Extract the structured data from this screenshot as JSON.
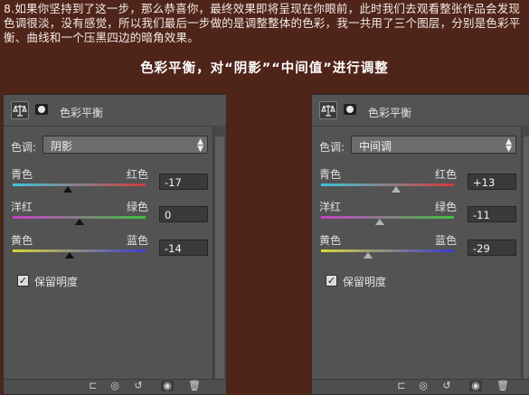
{
  "intro_text": "8.如果你坚持到了这一步，那么恭喜你，最终效果即将呈现在你眼前，此时我们去观看整张作品会发现色调很淡，没有感觉，所以我们最后一步做的是调整整体的色彩，我一共用了三个图层，分别是色彩平衡、曲线和一个压黑四边的暗角效果。",
  "headline": "色彩平衡，对“阴影”“中间值”进行调整",
  "panels": [
    {
      "title": "色彩平衡",
      "tone_label": "色调:",
      "tone_value": "阴影",
      "sliders": [
        {
          "left_label": "青色",
          "right_label": "红色",
          "value": "-17",
          "value_num": -17
        },
        {
          "left_label": "洋红",
          "right_label": "绿色",
          "value": "0",
          "value_num": 0
        },
        {
          "left_label": "黄色",
          "right_label": "蓝色",
          "value": "-14",
          "value_num": -14
        }
      ],
      "preserve_label": "保留明度",
      "preserve_checked": true
    },
    {
      "title": "色彩平衡",
      "tone_label": "色调:",
      "tone_value": "中间调",
      "sliders": [
        {
          "left_label": "青色",
          "right_label": "红色",
          "value": "+13",
          "value_num": 13
        },
        {
          "left_label": "洋红",
          "right_label": "绿色",
          "value": "-11",
          "value_num": -11
        },
        {
          "left_label": "黄色",
          "right_label": "蓝色",
          "value": "-29",
          "value_num": -29
        }
      ],
      "preserve_label": "保留明度",
      "preserve_checked": true
    }
  ],
  "slider_range": [
    -100,
    100
  ],
  "colors": {
    "background": "#4f2419",
    "panel": "#535353",
    "cyan_red": [
      "#3fc4d8",
      "#d23a3a"
    ],
    "magenta_green": [
      "#c840c8",
      "#3fbf3f"
    ],
    "yellow_blue": [
      "#d8d83a",
      "#3a3ad2"
    ]
  }
}
